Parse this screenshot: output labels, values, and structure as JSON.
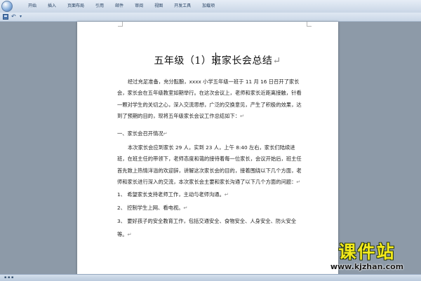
{
  "ribbon": {
    "tabs": [
      "开始",
      "插入",
      "页面布局",
      "引用",
      "邮件",
      "审阅",
      "视图",
      "开发工具",
      "加载项"
    ]
  },
  "quick_access": {
    "icons": [
      "save-icon",
      "undo-icon",
      "dropdown-icon"
    ]
  },
  "document": {
    "title": "五年级（1）班家长会总结",
    "intro": "经过充足准备，充分酝酿，xxxx 小学五年级一班于 11 月 16 日召开了家长会，家长会在五年级教室如期举行。在这次会议上，老师和家长近距离接触，针看一颗对学生的关切之心，深入交流思想，广泛的交换意见，产生了积极的效果，达到了预期的目的，现将五年级家长会议工作总结如下：",
    "section1": "一、家长会召开情况",
    "para2": "本次家长会应到家长 29 人，实到 23 人，上午 8:40 左右，家长们陆续进班，在班主任的带领下，老师态度和蔼的接待着每一位家长，会议开始后，班主任首先致上热情洋溢的欢迎辞，讲解这次家长会的目的，接着围绕以下几个方面，老师和家长进行深入的交流，本次家长会主要和家长沟通了以下几个方面的问题：",
    "list": [
      "1、  希望家长支持老师工作，主动与老师沟通。",
      "2、  控制学生上网、看电视。",
      "3、  要好孩子的安全教育工作，包括交通安全、食物安全、人身安全、防火安全等。"
    ],
    "para_mark": "↵"
  },
  "watermark": {
    "main": "课件站",
    "url": "www.kjzhan.com"
  }
}
